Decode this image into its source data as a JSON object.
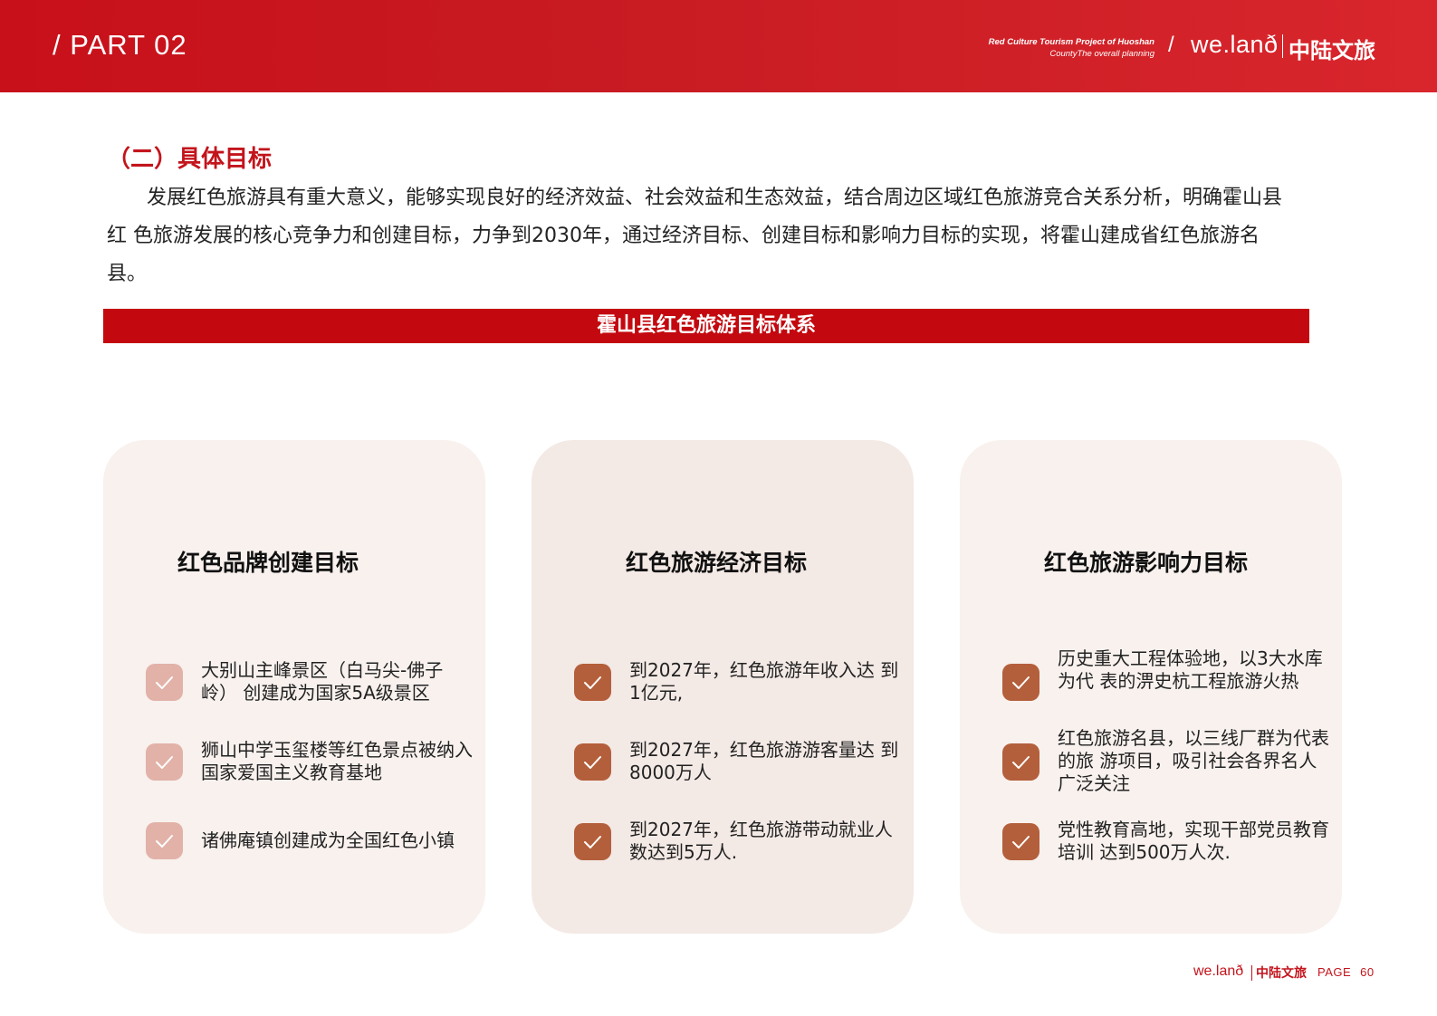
{
  "header": {
    "part_label": "/ PART 02",
    "subtitle_line1": "Red Culture Tourism Project of Huoshan",
    "subtitle_line2": "CountyThe overall planning",
    "slash": "/",
    "logo_en": "we.lanð",
    "logo_cn": "中陆文旅"
  },
  "section": {
    "title": "（二）具体目标",
    "intro": "发展红色旅游具有重大意义，能够实现良好的经济效益、社会效益和生态效益，结合周边区域红色旅游竞合关系分析，明确霍山县红 色旅游发展的核心竞争力和创建目标，力争到2030年，通过经济目标、创建目标和影响力目标的实现，将霍山建成省红色旅游名县。"
  },
  "banner": {
    "title": "霍山县红色旅游目标体系"
  },
  "cards": [
    {
      "title": "红色品牌创建目标",
      "items": [
        "大别山主峰景区（白马尖-佛子岭） 创建成为国家5A级景区",
        "狮山中学玉玺楼等红色景点被纳入国家爱国主义教育基地",
        "诸佛庵镇创建成为全国红色小镇"
      ]
    },
    {
      "title": "红色旅游经济目标",
      "items": [
        "到2027年，红色旅游年收入达 到1亿元,",
        "到2027年，红色旅游游客量达 到8000万人",
        "到2027年，红色旅游带动就业人数达到5万人."
      ]
    },
    {
      "title": "红色旅游影响力目标",
      "items": [
        "历史重大工程体验地，以3大水库为代 表的淠史杭工程旅游火热",
        "红色旅游名县，以三线厂群为代表的旅 游项目，吸引社会各界名人广泛关注",
        "党性教育高地，实现干部党员教育培训 达到500万人次."
      ]
    }
  ],
  "colors": {
    "brand_red": "#c3090f",
    "check_light": "#e2b2a8",
    "check_brown": "#b45f3b"
  },
  "icons": {
    "check": "check-icon"
  },
  "footer": {
    "logo_en": "we.lanð",
    "logo_cn": "中陆文旅",
    "page_label": "PAGE",
    "page_number": "60"
  }
}
